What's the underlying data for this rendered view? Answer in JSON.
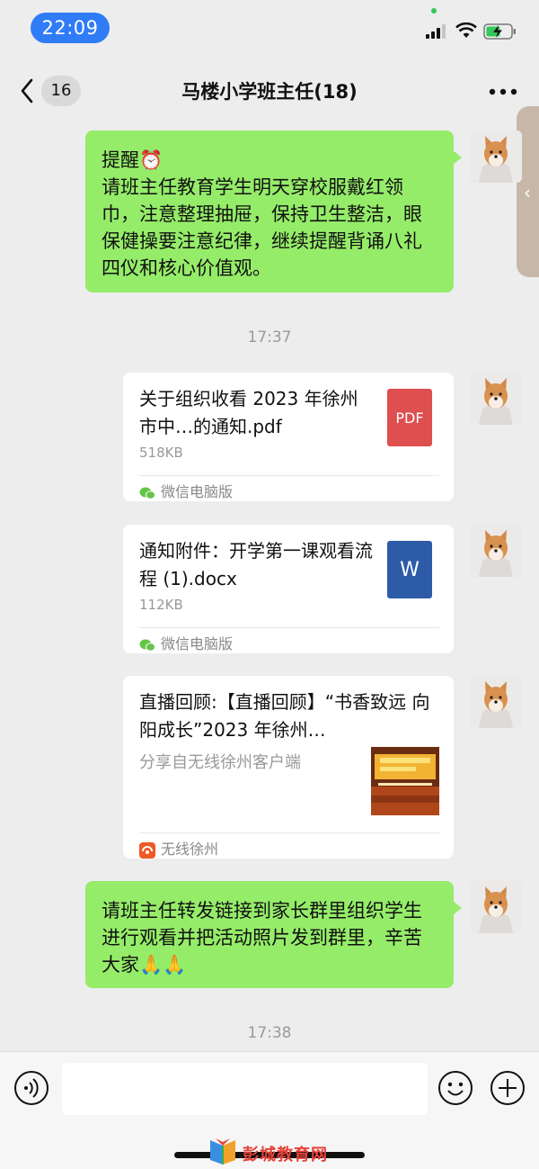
{
  "status_bar": {
    "time": "22:09"
  },
  "nav": {
    "back_count": "16",
    "title": "马楼小学班主任(18)"
  },
  "messages": {
    "m1": {
      "title": "提醒⏰",
      "text": "请班主任教育学生明天穿校服戴红领巾，注意整理抽屉，保持卫生整洁，眼保健操要注意纪律，继续提醒背诵八礼四仪和核心价值观。"
    },
    "t1": "17:37",
    "f1": {
      "title": "关于组织收看 2023 年徐州市中…的通知.pdf",
      "size": "518KB",
      "source": "微信电脑版",
      "icon": "pdf-icon",
      "icon_label": "PDF",
      "color": "#de4f4f"
    },
    "f2": {
      "title": "通知附件：开学第一课观看流程 (1).docx",
      "size": "112KB",
      "source": "微信电脑版",
      "icon": "word-icon",
      "icon_label": "W",
      "color": "#2e5ba8"
    },
    "link": {
      "title": "直播回顾:【直播回顾】“书香致远 向阳成长”2023 年徐州…",
      "desc": "分享自无线徐州客户端",
      "source": "无线徐州"
    },
    "m2": {
      "text": "请班主任转发链接到家长群里组织学生进行观看并把活动照片发到群里，辛苦大家🙏🙏"
    },
    "t2": "17:38"
  },
  "watermark": "彭城教育网"
}
